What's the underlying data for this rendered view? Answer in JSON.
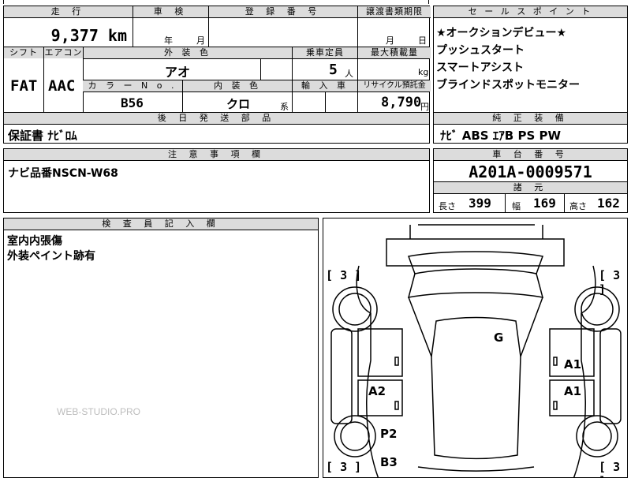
{
  "top_row": {
    "mileage_label": "走 行",
    "mileage_value": "9,377 km",
    "inspection_label": "車 検",
    "inspection_year": "年",
    "inspection_month": "月",
    "reg_label": "登 録 番 号",
    "transfer_label": "譲渡書類期限",
    "transfer_month": "月",
    "transfer_day": "日"
  },
  "row2": {
    "shift_label": "シフト",
    "ac_label": "エアコン",
    "color_label": "外 装 色",
    "capacity_label": "乗車定員",
    "load_label": "最大積載量",
    "shift_value": "FAT",
    "ac_value": "AAC",
    "color_value": "アオ",
    "capacity_value": "5",
    "capacity_unit": "人",
    "load_unit": "kg",
    "color_no_label": "カ ラ ー N o .",
    "interior_label": "内 装 色",
    "import_label": "輸 入 車",
    "recycle_label": "リサイクル預託金",
    "color_no_value": "B56",
    "interior_value": "クロ",
    "interior_suffix": "系",
    "recycle_value": "8,790",
    "recycle_unit": "円"
  },
  "shipping": {
    "label": "後 日 発 送 部 品",
    "value": "保証書 ﾅﾋﾞﾛﾑ"
  },
  "sales_point": {
    "label": "セ ー ル ス ポ イ ン ト",
    "lines": [
      "★オークションデビュー★",
      "プッシュスタート",
      "スマートアシスト",
      "ブラインドスポットモニター"
    ]
  },
  "equipment": {
    "label": "純 正 装 備",
    "value": "ﾅﾋﾞ  ABS  ｴｱB  PS  PW"
  },
  "notes": {
    "label": "注 意 事 項 欄",
    "value": "ナビ品番NSCN-W68"
  },
  "chassis": {
    "label": "車 台 番 号",
    "value": "A201A-0009571",
    "spec_label": "諸 元",
    "length_label": "長さ",
    "length_value": "399",
    "width_label": "幅",
    "width_value": "169",
    "height_label": "高さ",
    "height_value": "162"
  },
  "inspector": {
    "label": "検 査 員 記 入 欄",
    "lines": [
      "室内内張傷",
      "外装ペイント跡有"
    ]
  },
  "watermark": "WEB-STUDIO.PRO",
  "diagram": {
    "tire_tl": "3",
    "tire_tr": "3",
    "tire_bl": "3",
    "tire_br": "3",
    "bracket_open": "[",
    "bracket_close": "]",
    "mark_g": "G",
    "mark_a1_top": "A1",
    "mark_a2": "A2",
    "mark_a1_bottom": "A1",
    "mark_p2": "P2",
    "mark_b3": "B3"
  }
}
